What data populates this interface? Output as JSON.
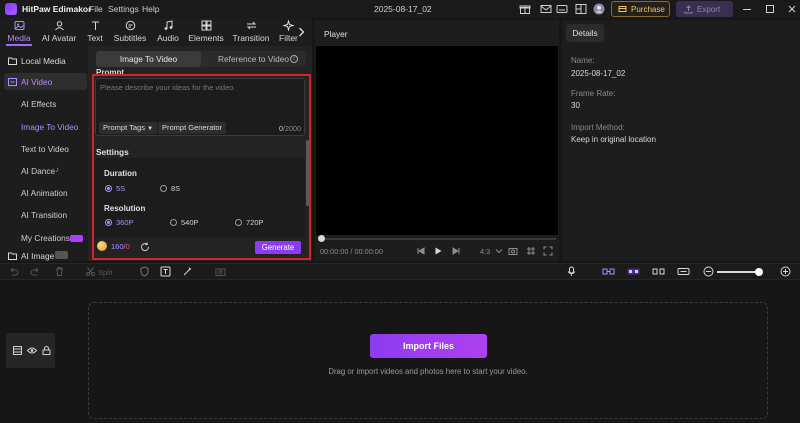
{
  "app": {
    "title": "HitPaw Edimakor",
    "menu": [
      "File",
      "Settings",
      "Help"
    ],
    "project_name": "2025-08-17_02",
    "purchase_label": "Purchase",
    "export_label": "Export"
  },
  "tabs": [
    {
      "label": "Media",
      "icon": "media-icon",
      "active": true
    },
    {
      "label": "AI Avatar",
      "icon": "avatar-icon"
    },
    {
      "label": "Text",
      "icon": "text-icon"
    },
    {
      "label": "Subtitles",
      "icon": "subtitles-icon"
    },
    {
      "label": "Audio",
      "icon": "audio-icon"
    },
    {
      "label": "Elements",
      "icon": "elements-icon"
    },
    {
      "label": "Transition",
      "icon": "transition-icon"
    },
    {
      "label": "Filter",
      "icon": "filter-icon"
    }
  ],
  "sidebar": {
    "local_media": "Local Media",
    "ai_video": "AI Video",
    "items": [
      "AI Effects",
      "Image To Video",
      "Text to Video",
      "AI Dance",
      "AI Animation",
      "AI Transition",
      "My Creations"
    ],
    "ai_image": "AI Image"
  },
  "generator": {
    "mode_tabs": [
      "Image To Video",
      "Reference to Video"
    ],
    "prompt_label": "Prompt",
    "prompt_placeholder": "Please describe your ideas for the video.",
    "prompt_tags": "Prompt Tags",
    "prompt_generator": "Prompt Generator",
    "char_count": "0",
    "char_max": "/2000",
    "settings_label": "Settings",
    "duration_label": "Duration",
    "duration_options": [
      "5S",
      "8S"
    ],
    "duration_selected": "5S",
    "resolution_label": "Resolution",
    "resolution_options": [
      "360P",
      "540P",
      "720P"
    ],
    "resolution_selected": "360P",
    "credits": "160",
    "credits_sep": "/",
    "credits_cost": "0",
    "generate_label": "Generate"
  },
  "player": {
    "title": "Player",
    "time": "00:00:00 / 00:00:00",
    "ratio": "4:3"
  },
  "details": {
    "tab": "Details",
    "fields": [
      {
        "k": "Name:",
        "v": "2025-08-17_02"
      },
      {
        "k": "Frame Rate:",
        "v": "30"
      },
      {
        "k": "Import Method:",
        "v": "Keep in original location"
      }
    ]
  },
  "timeline": {
    "split_label": "Split",
    "import_label": "Import Files",
    "drop_hint": "Drag or import videos and photos here to start your video."
  },
  "colors": {
    "accent": "#9b6bff",
    "generate": "#8b3cf2",
    "highlight_box": "#d4232a"
  }
}
